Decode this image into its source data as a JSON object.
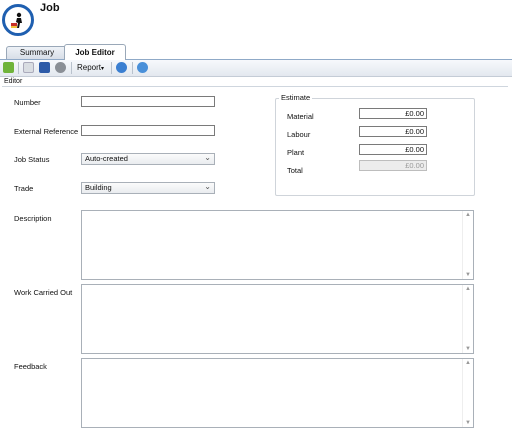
{
  "app": {
    "title": "Job"
  },
  "tabs": [
    {
      "label": "Summary",
      "active": false
    },
    {
      "label": "Job Editor",
      "active": true
    }
  ],
  "toolbar": {
    "report_label": "Report",
    "icons": [
      "new-icon",
      "document-icon",
      "save-icon",
      "cancel-icon",
      "refresh-icon",
      "help-icon"
    ]
  },
  "editor": {
    "label": "Editor",
    "fields": {
      "number": {
        "label": "Number",
        "value": ""
      },
      "external_reference": {
        "label": "External Reference",
        "value": ""
      },
      "job_status": {
        "label": "Job Status",
        "value": "Auto-created"
      },
      "trade": {
        "label": "Trade",
        "value": "Building"
      },
      "description": {
        "label": "Description",
        "value": ""
      },
      "work_carried_out": {
        "label": "Work Carried Out",
        "value": ""
      },
      "feedback": {
        "label": "Feedback",
        "value": ""
      }
    },
    "estimate": {
      "title": "Estimate",
      "material": {
        "label": "Material",
        "value": "£0.00"
      },
      "labour": {
        "label": "Labour",
        "value": "£0.00"
      },
      "plant": {
        "label": "Plant",
        "value": "£0.00"
      },
      "total": {
        "label": "Total",
        "value": "£0.00"
      }
    }
  },
  "colors": {
    "logo_ring": "#1f5fb0",
    "tab_border": "#8fa9c7"
  }
}
